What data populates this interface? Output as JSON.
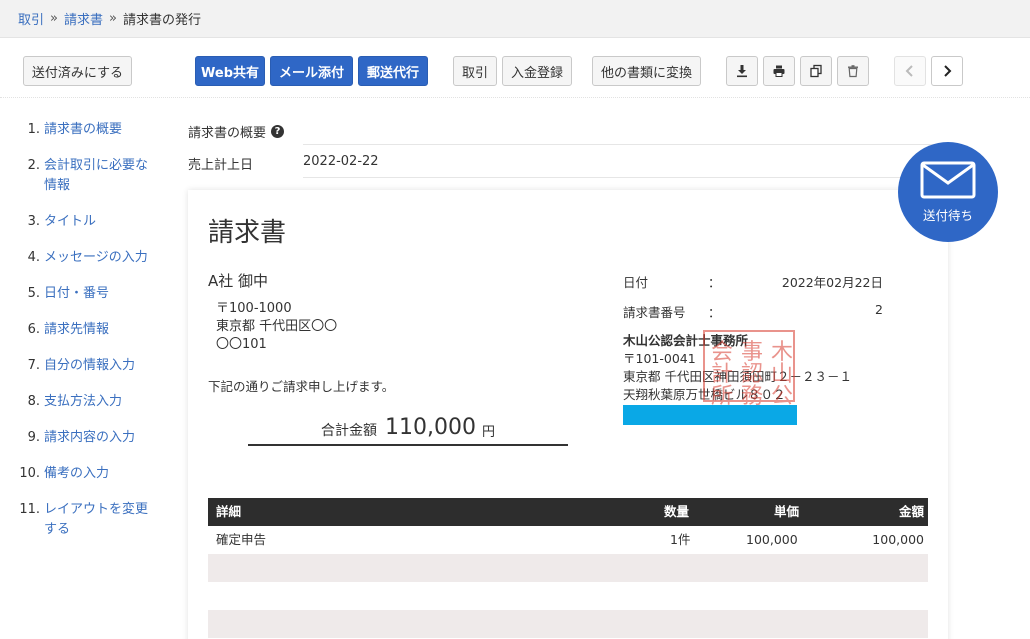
{
  "breadcrumb": {
    "item1": "取引",
    "item2": "請求書",
    "current": "請求書の発行",
    "separator": "»"
  },
  "toolbar": {
    "mark_sent": "送付済みにする",
    "web_share": "Web共有",
    "mail_attach": "メール添付",
    "mail_proxy": "郵送代行",
    "transaction": "取引",
    "payment": "入金登録",
    "convert": "他の書類に変換"
  },
  "icons": {
    "download": "download-icon",
    "print": "print-icon",
    "copy": "copy-icon",
    "trash": "trash-icon",
    "prev": "chevron-left-icon",
    "next": "chevron-right-icon",
    "mail": "mail-icon",
    "help": "help-icon"
  },
  "sidebar": {
    "items": [
      {
        "num": "1.",
        "label": "請求書の概要"
      },
      {
        "num": "2.",
        "label": "会計取引に必要な情報"
      },
      {
        "num": "3.",
        "label": "タイトル"
      },
      {
        "num": "4.",
        "label": "メッセージの入力"
      },
      {
        "num": "5.",
        "label": "日付・番号"
      },
      {
        "num": "6.",
        "label": "請求先情報"
      },
      {
        "num": "7.",
        "label": "自分の情報入力"
      },
      {
        "num": "8.",
        "label": "支払方法入力"
      },
      {
        "num": "9.",
        "label": "請求内容の入力"
      },
      {
        "num": "10.",
        "label": "備考の入力"
      },
      {
        "num": "11.",
        "label": "レイアウトを変更する"
      }
    ]
  },
  "summary": {
    "title": "請求書の概要",
    "help": "?",
    "sales_date_label": "売上計上日",
    "sales_date": "2022-02-22"
  },
  "status_badge": {
    "label": "送付待ち",
    "color": "#2f67c6"
  },
  "invoice": {
    "title": "請求書",
    "recipient": "A社 御中",
    "recipient_address": [
      "〒100-1000",
      "東京都 千代田区〇〇",
      "〇〇101"
    ],
    "intro": "下記の通りご請求申し上げます。",
    "total_label": "合計金額",
    "total_value": "110,000",
    "total_unit": "円",
    "date_label": "日付",
    "date_value": "2022年02月22日",
    "number_label": "請求書番号",
    "number_value": "2",
    "colon": "：",
    "seller_name": "木山公認会計士事務所",
    "seller_address": [
      "〒101-0041",
      "東京都 千代田区神田須田町２－２３－１",
      "天翔秋葉原万世橋ビル８０２"
    ],
    "seal_chars": [
      "木",
      "山",
      "公",
      "事",
      "認",
      "務",
      "会",
      "計",
      "所"
    ],
    "seal_color": "#d83b2f",
    "table": {
      "headers": [
        "詳細",
        "数量",
        "単価",
        "金額"
      ],
      "rows": [
        {
          "detail": "確定申告",
          "qty": "1件",
          "unit_price": "100,000",
          "amount": "100,000"
        }
      ]
    }
  }
}
